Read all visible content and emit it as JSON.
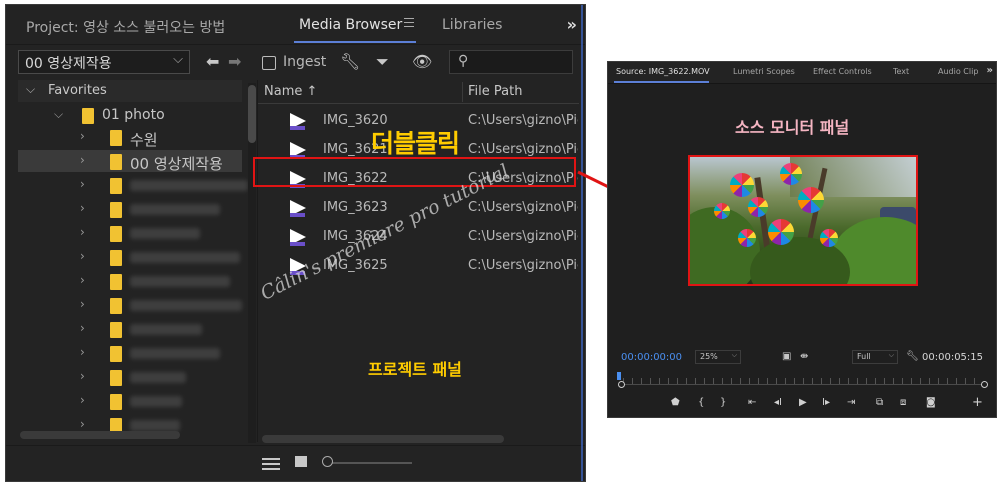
{
  "project_panel": {
    "tabs": {
      "project": "Project: 영상 소스 불러오는 방법",
      "media_browser": "Media Browser",
      "libraries": "Libraries",
      "more": "»"
    },
    "toolbar": {
      "location": "00 영상제작용",
      "ingest_label": "Ingest"
    },
    "tree": {
      "favorites_label": "Favorites",
      "folders": [
        {
          "label": "01 photo"
        },
        {
          "label": "수원"
        },
        {
          "label": "00 영상제작용"
        }
      ]
    },
    "files": {
      "col_name": "Name",
      "col_path": "File Path",
      "rows": [
        {
          "name": "IMG_3620",
          "path": "C:\\Users\\gizno\\Pic"
        },
        {
          "name": "IMG_3621",
          "path": "C:\\Users\\gizno\\Pic"
        },
        {
          "name": "IMG_3622",
          "path": "C:\\Users\\gizno\\Pic"
        },
        {
          "name": "IMG_3623",
          "path": "C:\\Users\\gizno\\Pic"
        },
        {
          "name": "IMG_3624",
          "path": "C:\\Users\\gizno\\Pic"
        },
        {
          "name": "IMG_3625",
          "path": "C:\\Users\\gizno\\Pic"
        }
      ]
    },
    "annotations": {
      "double_click": "더블클릭",
      "project_panel": "프로젝트 패널",
      "watermark": "Câlin's premiere pro tutorial"
    }
  },
  "source_monitor": {
    "tabs": {
      "source": "Source: IMG_3622.MOV",
      "lumetri": "Lumetri Scopes",
      "effect_controls": "Effect Controls",
      "text": "Text",
      "audio": "Audio Clip",
      "more": "»"
    },
    "annotation": "소스 모니터 패널",
    "timecode_in": "00:00:00:00",
    "zoom_level": "25%",
    "resolution": "Full",
    "timecode_duration": "00:00:05:15"
  },
  "colors": {
    "highlight_red": "#e01414",
    "annotation_yellow": "#ffcc00",
    "annotation_pink": "#f5b5c2",
    "folder_yellow": "#f1c232",
    "accent_blue": "#4a8ff0"
  }
}
